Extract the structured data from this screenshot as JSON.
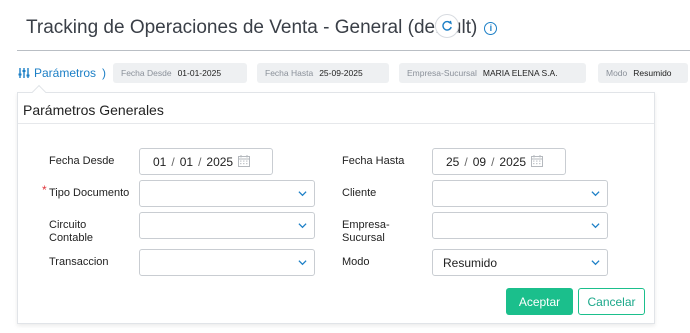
{
  "header": {
    "title": "Tracking de Operaciones de Venta - General (default)",
    "info_icon": "info-icon",
    "refresh_icon": "refresh-icon"
  },
  "params_bar": {
    "toggle_label": "Parámetros",
    "toggle_chevron": ")",
    "chips": [
      {
        "label": "Fecha Desde",
        "value": "01-01-2025"
      },
      {
        "label": "Fecha Hasta",
        "value": "25-09-2025"
      },
      {
        "label": "Empresa-Sucursal",
        "value": "MARIA ELENA S.A."
      },
      {
        "label": "Modo",
        "value": "Resumido"
      }
    ]
  },
  "panel": {
    "title": "Parámetros Generales",
    "fecha_desde": {
      "label": "Fecha Desde",
      "day": "01",
      "month": "01",
      "year": "2025"
    },
    "fecha_hasta": {
      "label": "Fecha Hasta",
      "day": "25",
      "month": "09",
      "year": "2025"
    },
    "tipo_documento": {
      "label": "Tipo Documento",
      "required_mark": "*",
      "value": ""
    },
    "cliente": {
      "label": "Cliente",
      "value": ""
    },
    "circuito_contable": {
      "label_line1": "Circuito",
      "label_line2": "Contable",
      "value": ""
    },
    "empresa_sucursal": {
      "label_line1": "Empresa-",
      "label_line2": "Sucursal",
      "value": ""
    },
    "transaccion": {
      "label": "Transaccion",
      "value": ""
    },
    "modo": {
      "label": "Modo",
      "value": "Resumido"
    }
  },
  "actions": {
    "accept_label": "Aceptar",
    "cancel_label": "Cancelar"
  },
  "colors": {
    "accent_blue": "#1c7fc6",
    "primary_green": "#1bbf8c",
    "required_red": "#e0353b"
  }
}
